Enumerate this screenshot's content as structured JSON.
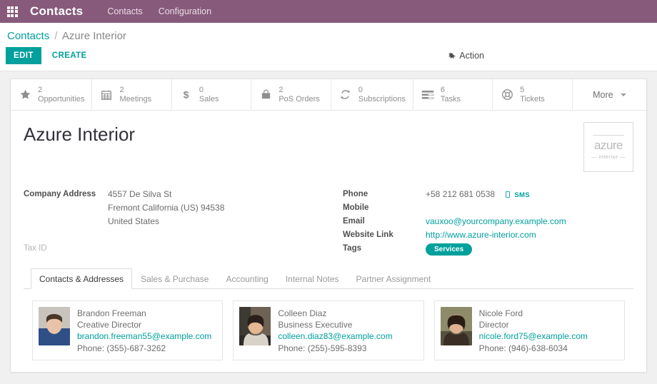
{
  "navbar": {
    "apps_icon": "apps-grid-icon",
    "title": "Contacts",
    "menu": [
      {
        "label": "Contacts"
      },
      {
        "label": "Configuration"
      }
    ]
  },
  "control_panel": {
    "breadcrumb": {
      "root": "Contacts",
      "separator": "/",
      "current": "Azure Interior"
    },
    "edit_label": "EDIT",
    "create_label": "CREATE",
    "action_label": "Action",
    "action_icon": "gear-icon"
  },
  "stat_buttons": [
    {
      "icon": "star-icon",
      "value": "2",
      "label": "Opportunities"
    },
    {
      "icon": "calendar-icon",
      "value": "2",
      "label": "Meetings"
    },
    {
      "icon": "dollar-icon",
      "value": "0",
      "label": "Sales"
    },
    {
      "icon": "shopping-bag-icon",
      "value": "2",
      "label": "PoS Orders"
    },
    {
      "icon": "refresh-icon",
      "value": "0",
      "label": "Subscriptions"
    },
    {
      "icon": "tasks-list-icon",
      "value": "6",
      "label": "Tasks"
    },
    {
      "icon": "lifebuoy-icon",
      "value": "5",
      "label": "Tickets"
    }
  ],
  "more_button": {
    "label": "More",
    "icon": "chevron-down-icon"
  },
  "record": {
    "title": "Azure Interior",
    "logo": {
      "main": "azure",
      "sub": "— interior —"
    },
    "left_fields": [
      {
        "label": "Company Address",
        "value": "4557 De Silva St"
      },
      {
        "label": "",
        "value": "Fremont  California (US)  94538"
      },
      {
        "label": "",
        "value": "United States"
      },
      {
        "label": "Tax ID",
        "value": ""
      }
    ],
    "right_fields": [
      {
        "label": "Phone",
        "value": "+58 212 681 0538",
        "sms": "SMS",
        "sms_icon": "mobile-icon"
      },
      {
        "label": "Mobile",
        "value": ""
      },
      {
        "label": "Email",
        "value": "vauxoo@yourcompany.example.com"
      },
      {
        "label": "Website Link",
        "value": "http://www.azure-interior.com"
      },
      {
        "label": "Tags",
        "value": "Services"
      }
    ]
  },
  "notebook": {
    "tabs": [
      {
        "label": "Contacts & Addresses",
        "active": true
      },
      {
        "label": "Sales & Purchase",
        "active": false
      },
      {
        "label": "Accounting",
        "active": false
      },
      {
        "label": "Internal Notes",
        "active": false
      },
      {
        "label": "Partner Assignment",
        "active": false
      }
    ],
    "contacts": [
      {
        "name": "Brandon Freeman",
        "role": "Creative Director",
        "email": "brandon.freeman55@example.com",
        "phone": "Phone: (355)-687-3262"
      },
      {
        "name": "Colleen Diaz",
        "role": "Business Executive",
        "email": "colleen.diaz83@example.com",
        "phone": "Phone: (255)-595-8393"
      },
      {
        "name": "Nicole Ford",
        "role": "Director",
        "email": "nicole.ford75@example.com",
        "phone": "Phone: (946)-638-6034"
      }
    ]
  },
  "colors": {
    "brand_purple": "#875A7B",
    "accent_teal": "#00A09D",
    "page_bg": "#F0F0F0"
  }
}
